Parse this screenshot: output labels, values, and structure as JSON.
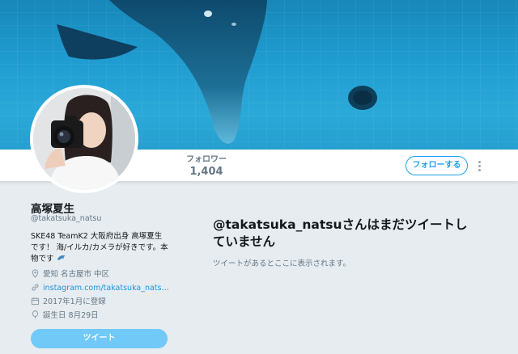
{
  "header": {
    "followers_label": "フォロワー",
    "followers_count": "1,404",
    "follow_label": "フォローする"
  },
  "profile": {
    "name": "高塚夏生",
    "handle": "@takatsuka_natsu",
    "bio": "SKE48 TeamK2 大阪府出身 高塚夏生です！ 海/イルカ/カメラが好きです。本物です",
    "location": "愛知 名古屋市 中区",
    "url": "instagram.com/takatsuka_nats…",
    "joined": "2017年1月に登録",
    "birthday": "誕生日 8月29日",
    "tweet_button": "ツイート"
  },
  "timeline": {
    "empty_title": "@takatsuka_natsuさんはまだツイートしていません",
    "empty_subtitle": "ツイートがあるとここに表示されます。"
  },
  "colors": {
    "accent": "#1da1f2",
    "link": "#1b95e0",
    "tweet_button": "#71c9f8",
    "page_background": "#e6ecf0"
  }
}
